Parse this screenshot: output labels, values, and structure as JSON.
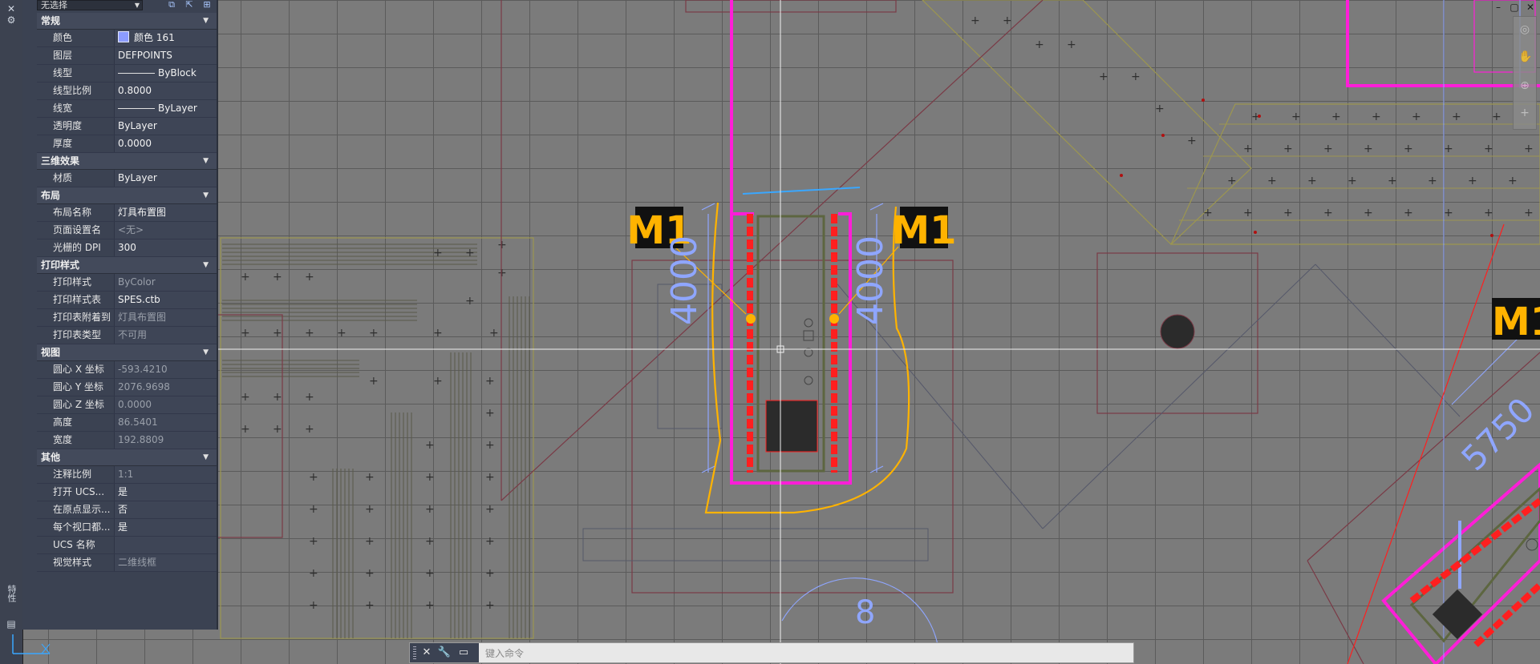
{
  "panel": {
    "selector_value": "无选择",
    "sections": [
      {
        "title": "常规",
        "rows": [
          {
            "key": "颜色",
            "value": "颜色 161",
            "swatch": true
          },
          {
            "key": "图层",
            "value": "DEFPOINTS"
          },
          {
            "key": "线型",
            "value": "ByBlock",
            "line": true
          },
          {
            "key": "线型比例",
            "value": "0.8000"
          },
          {
            "key": "线宽",
            "value": "ByLayer",
            "line": true
          },
          {
            "key": "透明度",
            "value": "ByLayer"
          },
          {
            "key": "厚度",
            "value": "0.0000"
          }
        ]
      },
      {
        "title": "三维效果",
        "rows": [
          {
            "key": "材质",
            "value": "ByLayer"
          }
        ]
      },
      {
        "title": "布局",
        "rows": [
          {
            "key": "布局名称",
            "value": "灯具布置图"
          },
          {
            "key": "页面设置名",
            "value": "<无>",
            "dim": true
          },
          {
            "key": "光栅的 DPI",
            "value": "300"
          }
        ]
      },
      {
        "title": "打印样式",
        "rows": [
          {
            "key": "打印样式",
            "value": "ByColor",
            "dim": true
          },
          {
            "key": "打印样式表",
            "value": "SPES.ctb"
          },
          {
            "key": "打印表附着到",
            "value": "灯具布置图",
            "dim": true
          },
          {
            "key": "打印表类型",
            "value": "不可用",
            "dim": true
          }
        ]
      },
      {
        "title": "视图",
        "rows": [
          {
            "key": "圆心 X 坐标",
            "value": "-593.4210",
            "dim": true
          },
          {
            "key": "圆心 Y 坐标",
            "value": "2076.9698",
            "dim": true
          },
          {
            "key": "圆心 Z 坐标",
            "value": "0.0000",
            "dim": true
          },
          {
            "key": "高度",
            "value": "86.5401",
            "dim": true
          },
          {
            "key": "宽度",
            "value": "192.8809",
            "dim": true
          }
        ]
      },
      {
        "title": "其他",
        "rows": [
          {
            "key": "注释比例",
            "value": "1:1",
            "dim": true
          },
          {
            "key": "打开 UCS...",
            "value": "是"
          },
          {
            "key": "在原点显示...",
            "value": "否"
          },
          {
            "key": "每个视口都...",
            "value": "是"
          },
          {
            "key": "UCS 名称",
            "value": ""
          },
          {
            "key": "视觉样式",
            "value": "二维线框",
            "dim": true
          }
        ]
      }
    ],
    "side_title": "特性"
  },
  "drawing": {
    "labels": {
      "m1_left": "M1",
      "m1_right": "M1",
      "m1_far": "M1",
      "dim_left": "4000",
      "dim_right": "4000",
      "dim_diag": "5750",
      "circle_num": "8"
    }
  },
  "command": {
    "placeholder": "键入命令"
  },
  "colors": {
    "magenta": "#ff1ed8",
    "red": "#ff1f1f",
    "yellow": "#ffb300",
    "blue_dim": "#8fa6ff",
    "olive": "#9c9650",
    "maroon": "#7a3a46"
  }
}
